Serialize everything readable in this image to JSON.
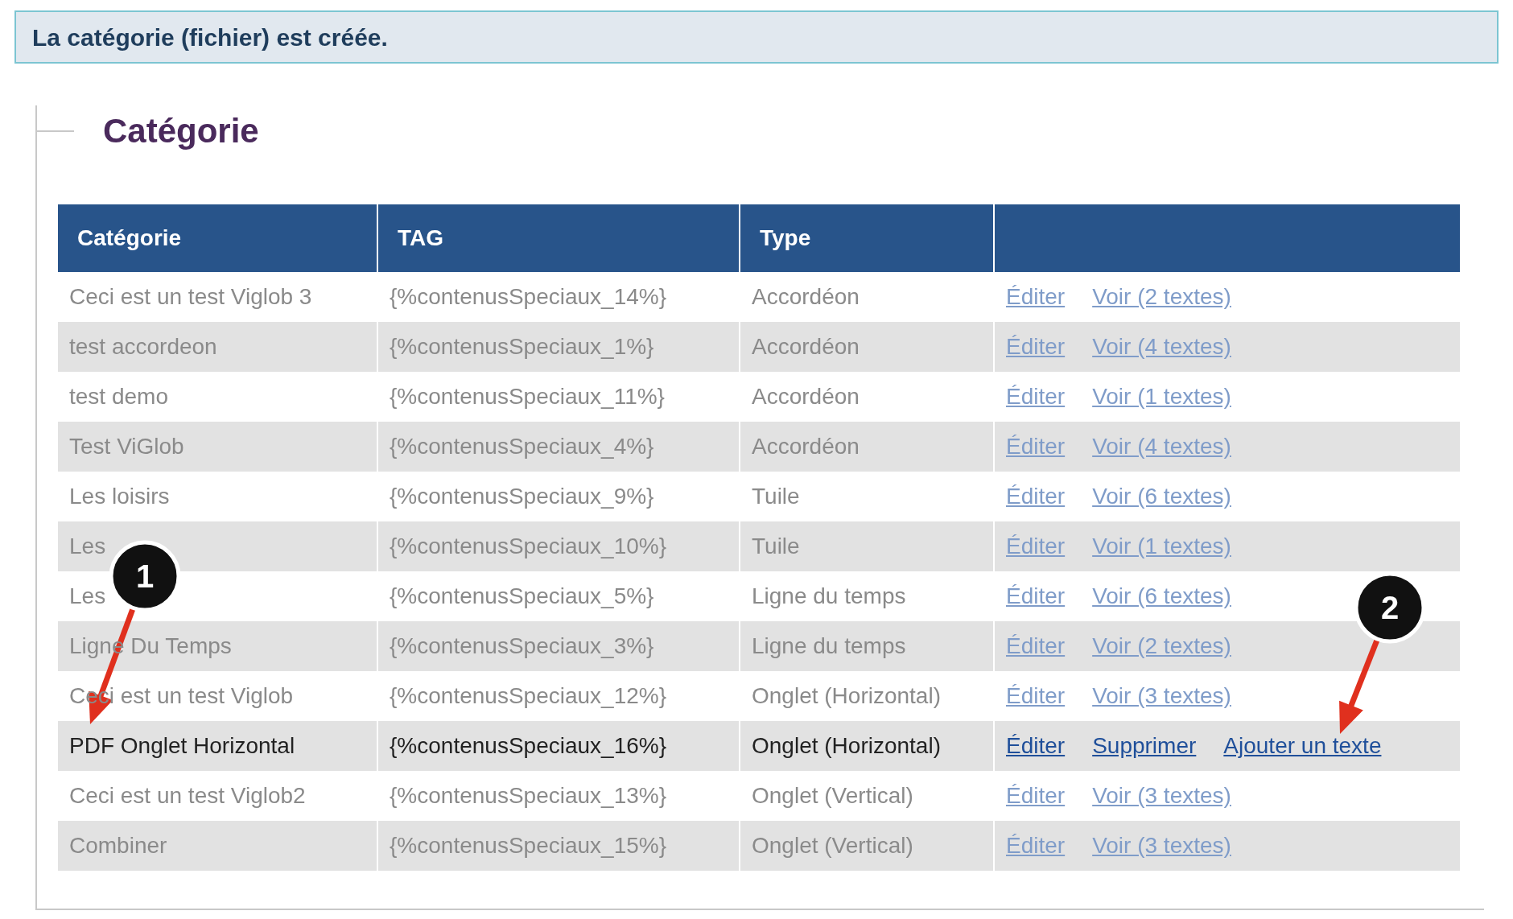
{
  "banner": {
    "text": "La catégorie (fichier) est créée."
  },
  "section": {
    "legend": "Catégorie"
  },
  "table": {
    "columns": [
      "Catégorie",
      "TAG",
      "Type"
    ],
    "rows": [
      {
        "category": "Ceci est un test Viglob 3",
        "tag": "{%contenusSpeciaux_14%}",
        "type": "Accordéon",
        "actions": [
          "Éditer",
          "Voir (2 textes)"
        ],
        "blurred": true
      },
      {
        "category": "test accordeon",
        "tag": "{%contenusSpeciaux_1%}",
        "type": "Accordéon",
        "actions": [
          "Éditer",
          "Voir (4 textes)"
        ],
        "blurred": true
      },
      {
        "category": "test demo",
        "tag": "{%contenusSpeciaux_11%}",
        "type": "Accordéon",
        "actions": [
          "Éditer",
          "Voir (1 textes)"
        ],
        "blurred": true
      },
      {
        "category": "Test ViGlob",
        "tag": "{%contenusSpeciaux_4%}",
        "type": "Accordéon",
        "actions": [
          "Éditer",
          "Voir (4 textes)"
        ],
        "blurred": true
      },
      {
        "category": "Les loisirs",
        "tag": "{%contenusSpeciaux_9%}",
        "type": "Tuile",
        "actions": [
          "Éditer",
          "Voir (6 textes)"
        ],
        "blurred": true
      },
      {
        "category": "Les",
        "tag": "{%contenusSpeciaux_10%}",
        "type": "Tuile",
        "actions": [
          "Éditer",
          "Voir (1 textes)"
        ],
        "blurred": true
      },
      {
        "category": "Les",
        "tag": "{%contenusSpeciaux_5%}",
        "type": "Ligne du temps",
        "actions": [
          "Éditer",
          "Voir (6 textes)"
        ],
        "blurred": true
      },
      {
        "category": "Ligne Du Temps",
        "tag": "{%contenusSpeciaux_3%}",
        "type": "Ligne du temps",
        "actions": [
          "Éditer",
          "Voir (2 textes)"
        ],
        "blurred": true
      },
      {
        "category": "Ceci est un test Viglob",
        "tag": "{%contenusSpeciaux_12%}",
        "type": "Onglet (Horizontal)",
        "actions": [
          "Éditer",
          "Voir (3 textes)"
        ],
        "blurred": true
      },
      {
        "category": "PDF Onglet Horizontal",
        "tag": "{%contenusSpeciaux_16%}",
        "type": "Onglet (Horizontal)",
        "actions": [
          "Éditer",
          "Supprimer",
          "Ajouter un texte"
        ],
        "blurred": false
      },
      {
        "category": "Ceci est un test Viglob2",
        "tag": "{%contenusSpeciaux_13%}",
        "type": "Onglet (Vertical)",
        "actions": [
          "Éditer",
          "Voir (3 textes)"
        ],
        "blurred": true
      },
      {
        "category": "Combiner",
        "tag": "{%contenusSpeciaux_15%}",
        "type": "Onglet (Vertical)",
        "actions": [
          "Éditer",
          "Voir (3 textes)"
        ],
        "blurred": true
      }
    ]
  },
  "callouts": [
    {
      "label": "1"
    },
    {
      "label": "2"
    }
  ]
}
